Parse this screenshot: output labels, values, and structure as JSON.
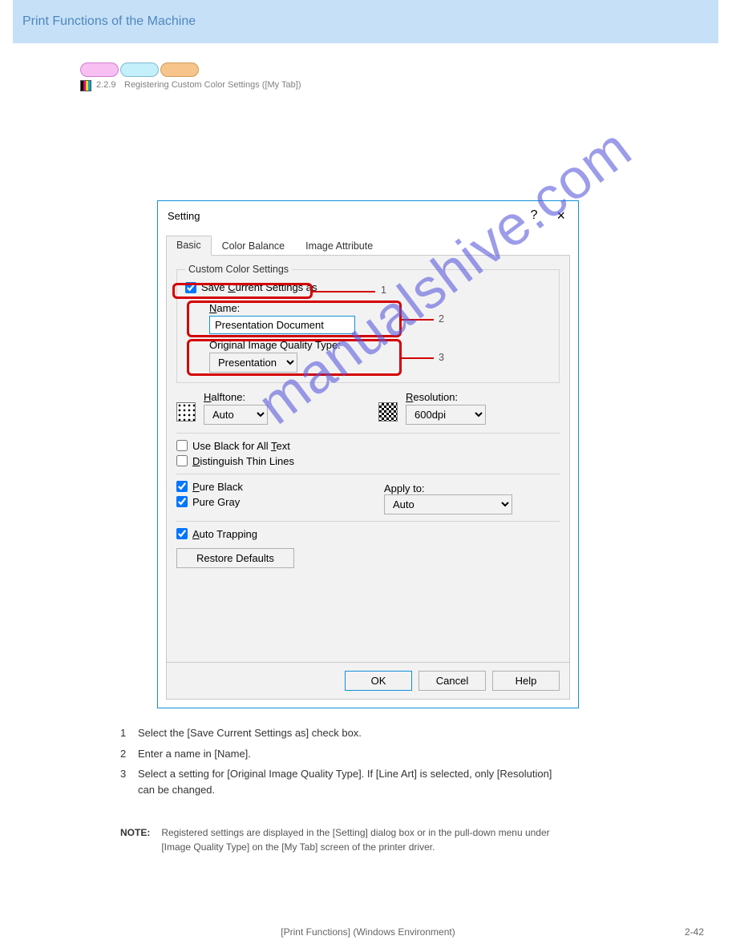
{
  "page": {
    "header_title": "Print Functions of the Machine",
    "section_number": "2.2.9",
    "section_name": "Registering Custom Color Settings ([My Tab])",
    "footer_center": "[Print Functions] (Windows Environment)",
    "footer_right": "2-42"
  },
  "pills": {
    "present": true
  },
  "dialog": {
    "title": "Setting",
    "help_icon": "?",
    "close_icon": "×",
    "tabs": {
      "basic": "Basic",
      "color_balance": "Color Balance",
      "image_attribute": "Image Attribute"
    },
    "groupbox_title": "Custom Color Settings",
    "save_current_label_pre": "Save ",
    "save_current_label_u": "C",
    "save_current_label_post": "urrent Settings as",
    "save_current_checked": true,
    "name_label_u": "N",
    "name_label_post": "ame:",
    "name_value": "Presentation Document",
    "oiqt_label": "Original Image Quality Type:",
    "oiqt_value": "Presentation",
    "halftone_u": "H",
    "halftone_post": "alftone:",
    "halftone_value": "Auto",
    "resolution_u": "R",
    "resolution_post": "esolution:",
    "resolution_value": "600dpi",
    "use_black_pre": "Use Black for All ",
    "use_black_u": "T",
    "use_black_post": "ext",
    "distinguish_u": "D",
    "distinguish_post": "istinguish Thin Lines",
    "pure_black_u": "P",
    "pure_black_post": "ure Black",
    "pure_gray_label": "Pure Gray",
    "apply_to_label": "Apply to:",
    "apply_to_value": "Auto",
    "auto_trap_u": "A",
    "auto_trap_post": "uto Trapping",
    "restore_label": "Restore Defaults",
    "ok": "OK",
    "cancel": "Cancel",
    "help": "Help"
  },
  "callouts": {
    "a1": "1",
    "a2": "2",
    "a3": "3"
  },
  "description": {
    "d1_num": "1",
    "d1_text": "Select the [Save Current Settings as] check box.",
    "d2_num": "2",
    "d2_text": "Enter a name in [Name].",
    "d3_num": "3",
    "d3_text": "Select a setting for [Original Image Quality Type]. If [Line Art] is selected, only [Resolution] can be changed."
  },
  "note": {
    "label": "NOTE:",
    "text": "Registered settings are displayed in the [Setting] dialog box or in the pull-down menu under [Image Quality Type] on the [My Tab] screen of the printer driver."
  },
  "watermark": "manualshive.com"
}
